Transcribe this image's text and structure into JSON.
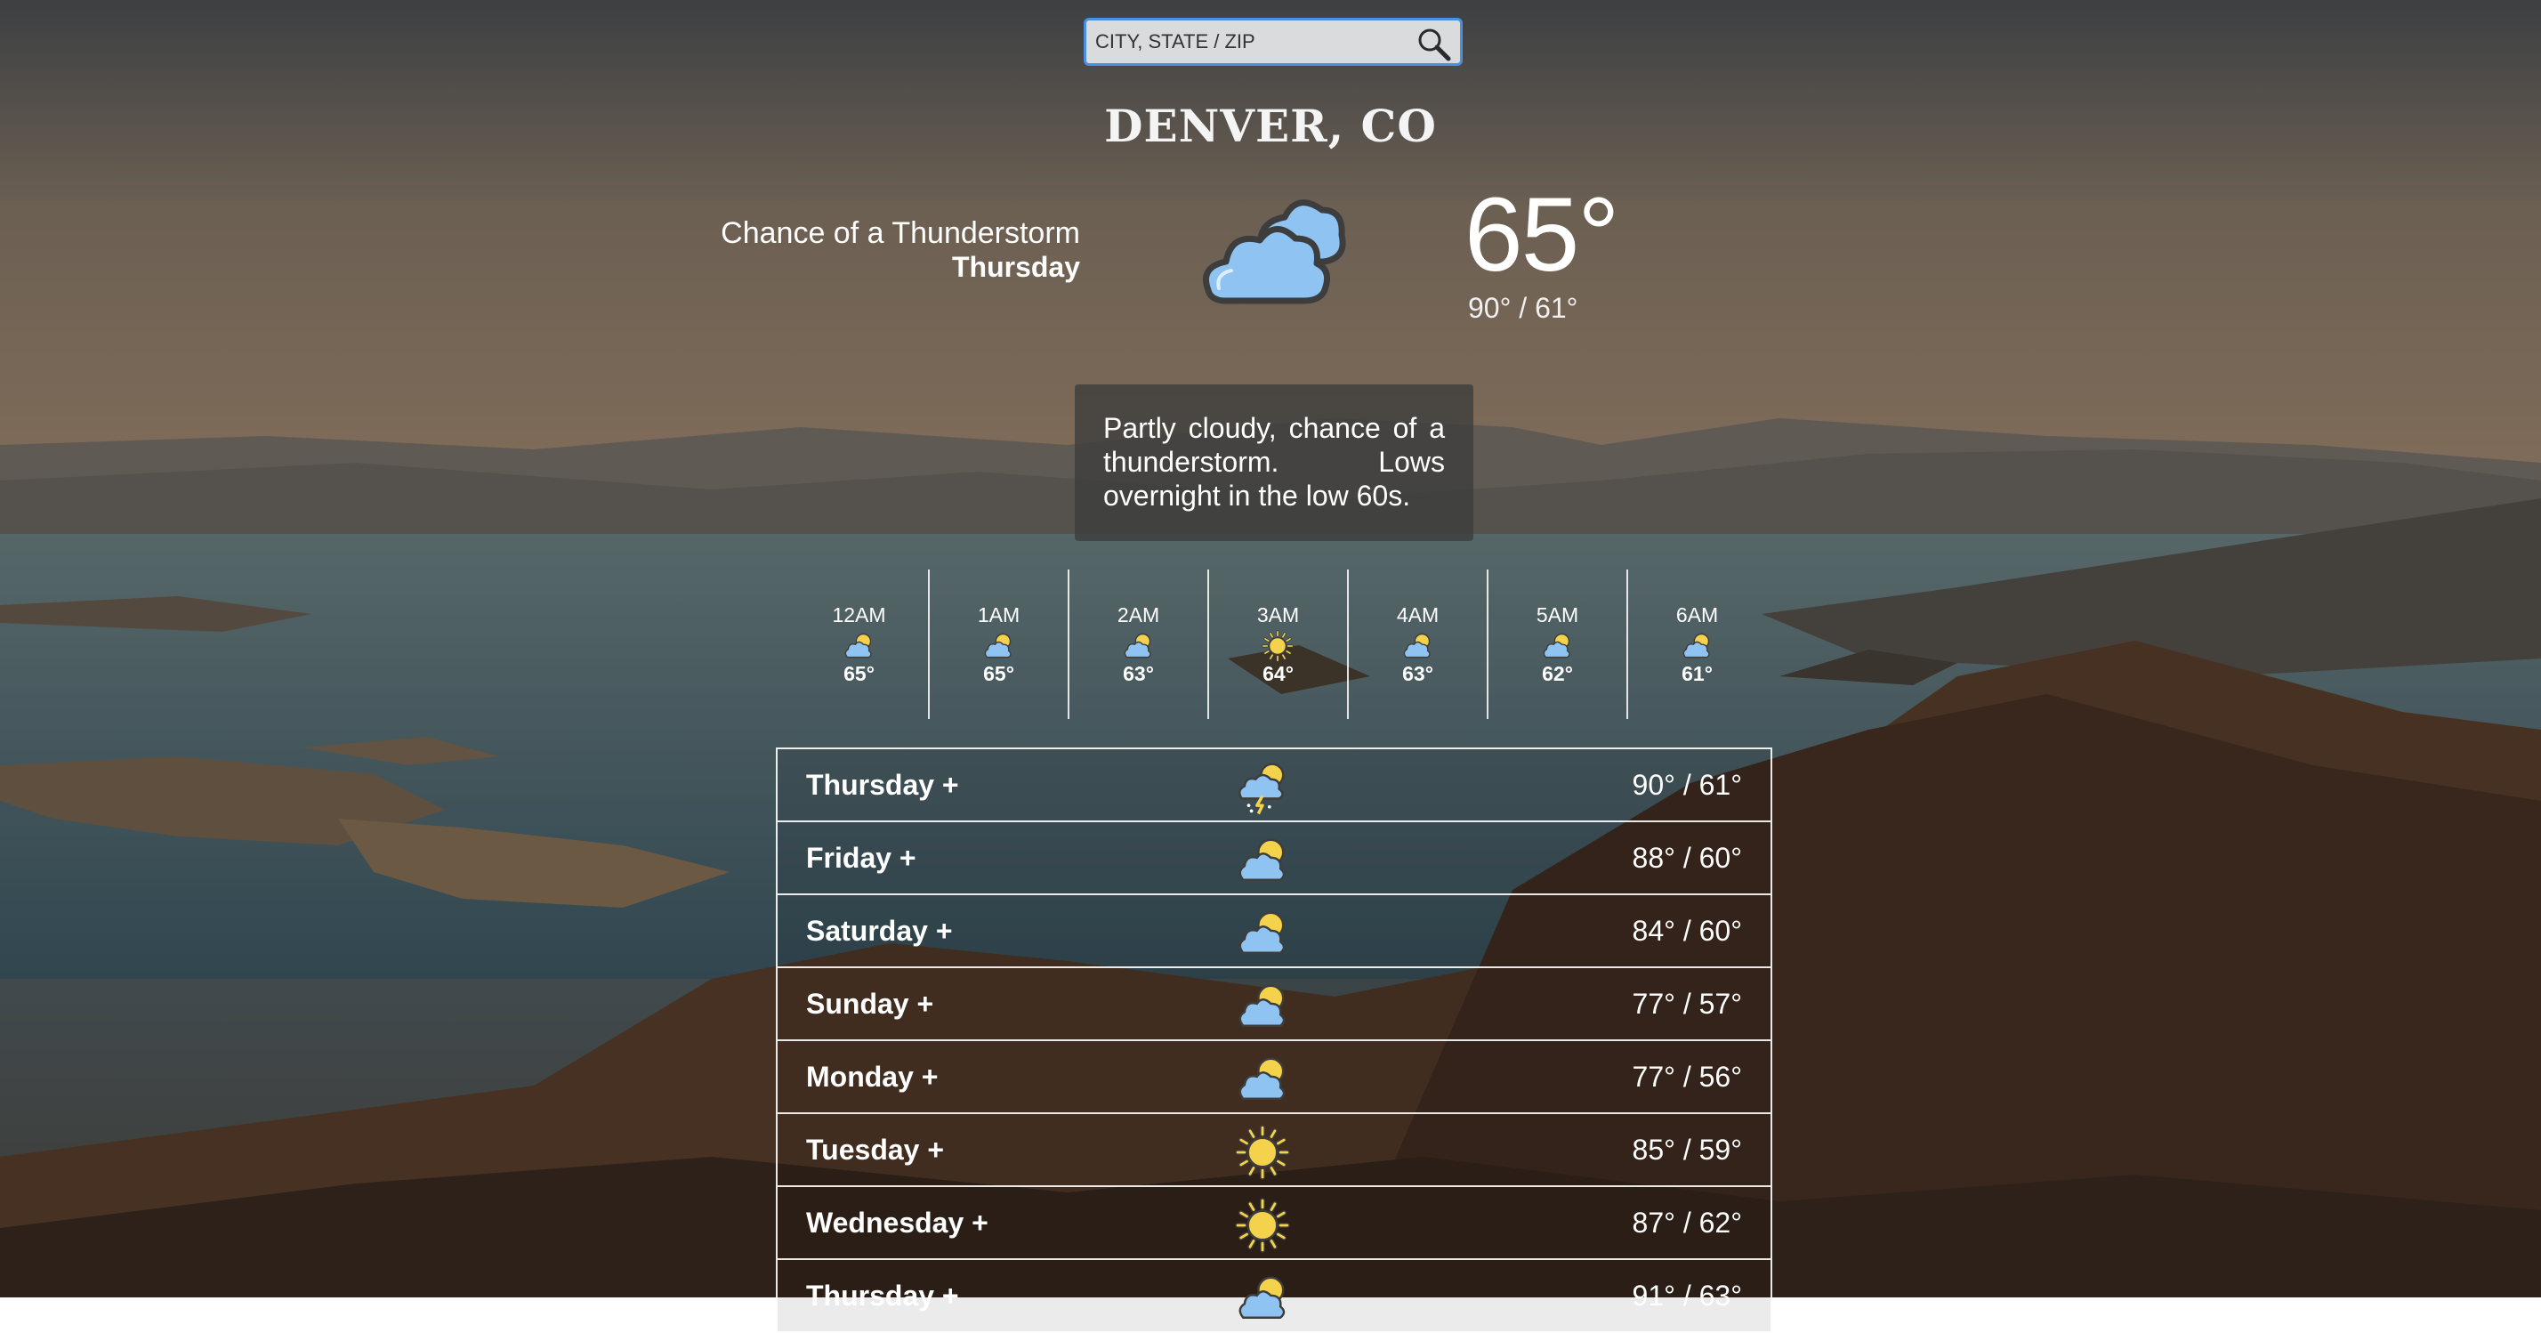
{
  "search": {
    "placeholder": "CITY, STATE / ZIP"
  },
  "location": {
    "city": "DENVER, CO"
  },
  "current": {
    "condition": "Chance of a Thunderstorm",
    "day": "Thursday",
    "temp": "65°",
    "hilo": "90° / 61°",
    "icon": "partly-cloudy-icon"
  },
  "description": "Partly cloudy, chance of a thunderstorm. Lows overnight in the low 60s.",
  "hourly": [
    {
      "time": "12AM",
      "temp": "65°",
      "icon": "partly-cloudy-icon"
    },
    {
      "time": "1AM",
      "temp": "65°",
      "icon": "partly-cloudy-icon"
    },
    {
      "time": "2AM",
      "temp": "63°",
      "icon": "partly-cloudy-icon"
    },
    {
      "time": "3AM",
      "temp": "64°",
      "icon": "sun-icon"
    },
    {
      "time": "4AM",
      "temp": "63°",
      "icon": "partly-cloudy-icon"
    },
    {
      "time": "5AM",
      "temp": "62°",
      "icon": "partly-cloudy-icon"
    },
    {
      "time": "6AM",
      "temp": "61°",
      "icon": "partly-cloudy-icon"
    }
  ],
  "daily": [
    {
      "day": "Thursday +",
      "temp": "90° / 61°",
      "icon": "thunderstorm-icon"
    },
    {
      "day": "Friday +",
      "temp": "88° / 60°",
      "icon": "partly-cloudy-icon"
    },
    {
      "day": "Saturday +",
      "temp": "84° / 60°",
      "icon": "partly-cloudy-icon"
    },
    {
      "day": "Sunday +",
      "temp": "77° / 57°",
      "icon": "partly-cloudy-icon"
    },
    {
      "day": "Monday +",
      "temp": "77° / 56°",
      "icon": "partly-cloudy-icon"
    },
    {
      "day": "Tuesday +",
      "temp": "85° / 59°",
      "icon": "sun-icon"
    },
    {
      "day": "Wednesday +",
      "temp": "87° / 62°",
      "icon": "sun-icon"
    },
    {
      "day": "Thursday +",
      "temp": "91° / 63°",
      "icon": "partly-cloudy-icon"
    }
  ],
  "colors": {
    "search_border": "#4a90e2",
    "cloud_fill": "#8fc4f2",
    "sun_fill": "#f5d24b",
    "icon_outline": "#3d3d3d"
  }
}
